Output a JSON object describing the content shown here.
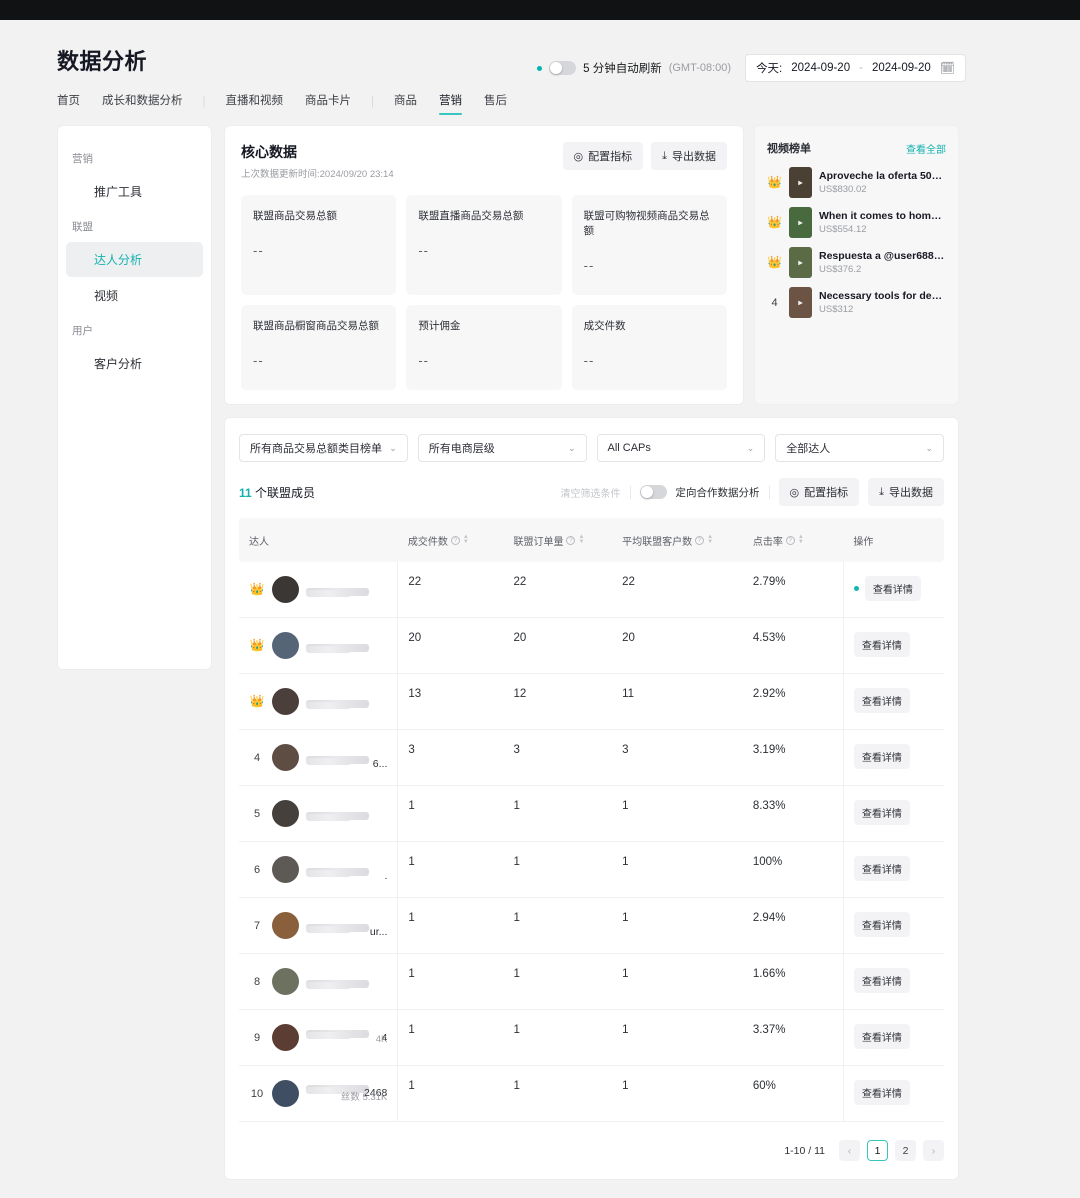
{
  "header": {
    "title": "数据分析",
    "auto_refresh_label": "5 分钟自动刷新",
    "timezone": "(GMT-08:00)",
    "date_prefix": "今天:",
    "date_start": "2024-09-20",
    "date_sep": "-",
    "date_end": "2024-09-20",
    "calendar_icon": "calendar-icon"
  },
  "tabs": [
    {
      "label": "首页",
      "active": false
    },
    {
      "label": "成长和数据分析",
      "active": false
    },
    {
      "divider": "|"
    },
    {
      "label": "直播和视频",
      "active": false
    },
    {
      "label": "商品卡片",
      "active": false
    },
    {
      "divider": "|"
    },
    {
      "label": "商品",
      "active": false
    },
    {
      "label": "营销",
      "active": true
    },
    {
      "label": "售后",
      "active": false
    }
  ],
  "sidebar": {
    "groups": [
      {
        "label": "营销",
        "items": [
          {
            "label": "推广工具",
            "active": false
          }
        ]
      },
      {
        "label": "联盟",
        "items": [
          {
            "label": "达人分析",
            "active": true
          },
          {
            "label": "视频",
            "active": false
          }
        ]
      },
      {
        "label": "用户",
        "items": [
          {
            "label": "客户分析",
            "active": false
          }
        ]
      }
    ]
  },
  "core": {
    "title": "核心数据",
    "subtitle": "上次数据更新时间:2024/09/20 23:14",
    "config_btn": "配置指标",
    "export_btn": "导出数据",
    "metrics": [
      {
        "label": "联盟商品交易总额",
        "value": "--"
      },
      {
        "label": "联盟直播商品交易总额",
        "value": "--"
      },
      {
        "label": "联盟可购物视频商品交易总额",
        "value": "--"
      },
      {
        "label": "联盟商品橱窗商品交易总额",
        "value": "--"
      },
      {
        "label": "预计佣金",
        "value": "--"
      },
      {
        "label": "成交件数",
        "value": "--"
      }
    ]
  },
  "video_panel": {
    "title": "视频榜单",
    "view_all": "查看全部",
    "items": [
      {
        "rank": "1",
        "medal": "gold",
        "title": "Aproveche la oferta 50% ...",
        "price": "US$830.02",
        "thumb": "#4a4034"
      },
      {
        "rank": "2",
        "medal": "silver",
        "title": "When it comes to home r...",
        "price": "US$554.12",
        "thumb": "#49693e"
      },
      {
        "rank": "3",
        "medal": "bronze",
        "title": "Respuesta a @user68859...",
        "price": "US$376.2",
        "thumb": "#5a6b45"
      },
      {
        "rank": "4",
        "medal": "none",
        "title": "Necessary tools for decor...",
        "price": "US$312",
        "thumb": "#6b5444"
      }
    ]
  },
  "filters": [
    {
      "label": "所有商品交易总额类目榜单"
    },
    {
      "label": "所有电商层级"
    },
    {
      "label": "All CAPs"
    },
    {
      "label": "全部达人"
    }
  ],
  "table_toolbar": {
    "count_number": "11",
    "count_suffix": "个联盟成员",
    "clear_filters": "清空筛选条件",
    "targeted_analysis": "定向合作数据分析",
    "config_btn": "配置指标",
    "export_btn": "导出数据"
  },
  "table": {
    "columns": [
      {
        "label": "达人",
        "help": false,
        "sortable": false
      },
      {
        "label": "成交件数",
        "help": true,
        "sortable": true
      },
      {
        "label": "联盟订单量",
        "help": true,
        "sortable": true
      },
      {
        "label": "平均联盟客户数",
        "help": true,
        "sortable": true
      },
      {
        "label": "点击率",
        "help": true,
        "sortable": true
      },
      {
        "label": "操作",
        "help": false,
        "sortable": false
      }
    ],
    "detail_label": "查看详情",
    "rows": [
      {
        "rank": "1",
        "medal": "gold",
        "name": "",
        "sub": "",
        "avatar": "#3b3734",
        "orders": "22",
        "aff_orders": "22",
        "avg_customers": "22",
        "ctr": "2.79%",
        "online": true
      },
      {
        "rank": "2",
        "medal": "silver",
        "name": "",
        "sub": "",
        "avatar": "#566477",
        "orders": "20",
        "aff_orders": "20",
        "avg_customers": "20",
        "ctr": "4.53%",
        "online": false
      },
      {
        "rank": "3",
        "medal": "bronze",
        "name": "",
        "sub": "",
        "avatar": "#4a3f3a",
        "orders": "13",
        "aff_orders": "12",
        "avg_customers": "11",
        "ctr": "2.92%",
        "online": false
      },
      {
        "rank": "4",
        "medal": "none",
        "name": "6...",
        "sub": "",
        "avatar": "#5e4d42",
        "orders": "3",
        "aff_orders": "3",
        "avg_customers": "3",
        "ctr": "3.19%",
        "online": false
      },
      {
        "rank": "5",
        "medal": "none",
        "name": "",
        "sub": "",
        "avatar": "#46403d",
        "orders": "1",
        "aff_orders": "1",
        "avg_customers": "1",
        "ctr": "8.33%",
        "online": false
      },
      {
        "rank": "6",
        "medal": "none",
        "name": ".",
        "sub": "",
        "avatar": "#5d5a55",
        "orders": "1",
        "aff_orders": "1",
        "avg_customers": "1",
        "ctr": "100%",
        "online": false
      },
      {
        "rank": "7",
        "medal": "none",
        "name": "ur...",
        "sub": "",
        "avatar": "#8a5f3c",
        "orders": "1",
        "aff_orders": "1",
        "avg_customers": "1",
        "ctr": "2.94%",
        "online": false
      },
      {
        "rank": "8",
        "medal": "none",
        "name": "",
        "sub": "",
        "avatar": "#6d7260",
        "orders": "1",
        "aff_orders": "1",
        "avg_customers": "1",
        "ctr": "1.66%",
        "online": false
      },
      {
        "rank": "9",
        "medal": "none",
        "name": "4",
        "sub": "4K",
        "avatar": "#5b3d33",
        "orders": "1",
        "aff_orders": "1",
        "avg_customers": "1",
        "ctr": "3.37%",
        "online": false
      },
      {
        "rank": "10",
        "medal": "none",
        "name": "2468",
        "sub": "丝数 5.31K",
        "avatar": "#3f4e63",
        "orders": "1",
        "aff_orders": "1",
        "avg_customers": "1",
        "ctr": "60%",
        "online": false
      }
    ]
  },
  "pagination": {
    "info": "1-10 / 11",
    "prev": "‹",
    "next": "›",
    "pages": [
      {
        "label": "1",
        "active": true
      },
      {
        "label": "2",
        "active": false
      }
    ]
  },
  "colors": {
    "accent": "#14b2ae",
    "tab_underline": "#39c5c1",
    "page_bg": "#f2f2f2",
    "top_strip": "#111214"
  }
}
